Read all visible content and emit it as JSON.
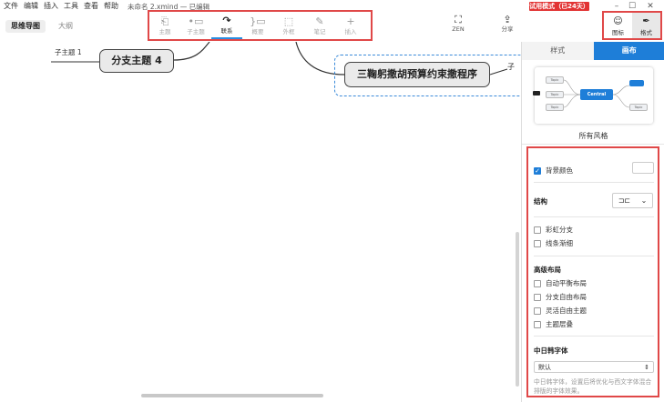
{
  "menu": {
    "items": [
      "文件",
      "编辑",
      "插入",
      "工具",
      "查看",
      "帮助"
    ],
    "file_title": "未命名 2.xmind — 已编辑",
    "trial_badge": "试用模式（已24天）"
  },
  "view_tabs": {
    "mindmap": "思维导图",
    "outline": "大纲"
  },
  "toolbar": {
    "tools": [
      {
        "label": "主题",
        "icon": "topic-icon",
        "glyph": "⎗"
      },
      {
        "label": "子主题",
        "icon": "subtopic-icon",
        "glyph": "•▭"
      },
      {
        "label": "联系",
        "icon": "relationship-icon",
        "glyph": "↷"
      },
      {
        "label": "概要",
        "icon": "summary-icon",
        "glyph": "}▭"
      },
      {
        "label": "外框",
        "icon": "boundary-icon",
        "glyph": "⬚"
      },
      {
        "label": "笔记",
        "icon": "note-icon",
        "glyph": "✎"
      },
      {
        "label": "插入",
        "icon": "insert-icon",
        "glyph": "+"
      }
    ],
    "zen": "ZEN",
    "share": "分享",
    "sticker": "图标",
    "format": "格式"
  },
  "canvas": {
    "subtopic": "子主题 1",
    "branch": "分支主题 4",
    "main_topic": "三鞠躬撒胡预算约束撒程序",
    "clipped": "子"
  },
  "panel": {
    "tab_style": "样式",
    "tab_canvas": "画布",
    "preview_central": "Central",
    "preview_topic": "Topic",
    "all_styles": "所有风格",
    "bg_color": "背景颜色",
    "structure": "结构",
    "rainbow": "彩虹分支",
    "thin_lines": "线条渐细",
    "advanced": "高级布局",
    "auto_balance": "自动平衡布局",
    "free_branch": "分支自由布局",
    "free_topic": "灵活自由主题",
    "overlap": "主题层叠",
    "cjk_font": "中日韩字体",
    "font_value": "默认",
    "font_hint": "中日韩字体，设置后将优化与西文字体混合排版的字体效果。"
  },
  "colors": {
    "accent": "#1e7ed8",
    "highlight_box": "#e04848",
    "trial": "#e23434"
  }
}
